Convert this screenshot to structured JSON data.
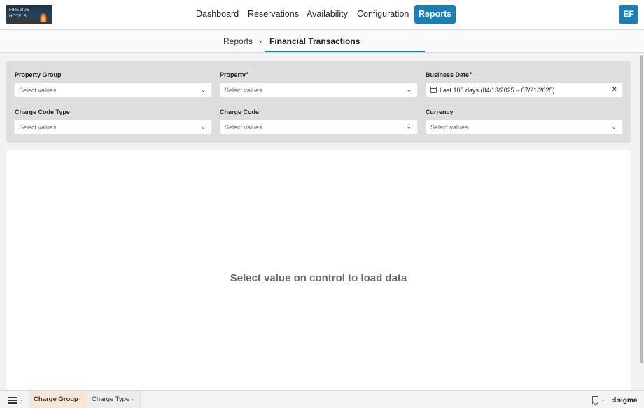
{
  "logo": {
    "text_line1": "FIRESIDE",
    "text_line2": "HOTELS"
  },
  "nav": {
    "items": [
      {
        "label": "Dashboard",
        "active": false
      },
      {
        "label": "Reservations",
        "active": false
      },
      {
        "label": "Availability",
        "active": false
      },
      {
        "label": "Configuration",
        "active": false
      },
      {
        "label": "Reports",
        "active": true
      }
    ],
    "user_initials": "EF",
    "accent_color": "#1b7fb6"
  },
  "breadcrumb": {
    "parent": "Reports",
    "separator": "›",
    "current": "Financial Transactions"
  },
  "filters": [
    {
      "label": "Property Group",
      "required": false,
      "placeholder": "Select values",
      "value": ""
    },
    {
      "label": "Property",
      "required": true,
      "placeholder": "Select values",
      "value": ""
    },
    {
      "label": "Business Date",
      "required": true,
      "placeholder": "",
      "value": "Last 100 days (04/13/2025 – 07/21/2025)"
    },
    {
      "label": "Charge Code Type",
      "required": false,
      "placeholder": "Select values",
      "value": ""
    },
    {
      "label": "Charge Code",
      "required": false,
      "placeholder": "Select values",
      "value": ""
    },
    {
      "label": "Currency",
      "required": false,
      "placeholder": "Select values",
      "value": ""
    }
  ],
  "required_marker": "*",
  "content": {
    "empty_message": "Select value on control to load data"
  },
  "bottom": {
    "tabs": [
      {
        "label": "Charge Group",
        "active": true
      },
      {
        "label": "Charge Type",
        "active": false
      }
    ],
    "brand": "sigma"
  }
}
